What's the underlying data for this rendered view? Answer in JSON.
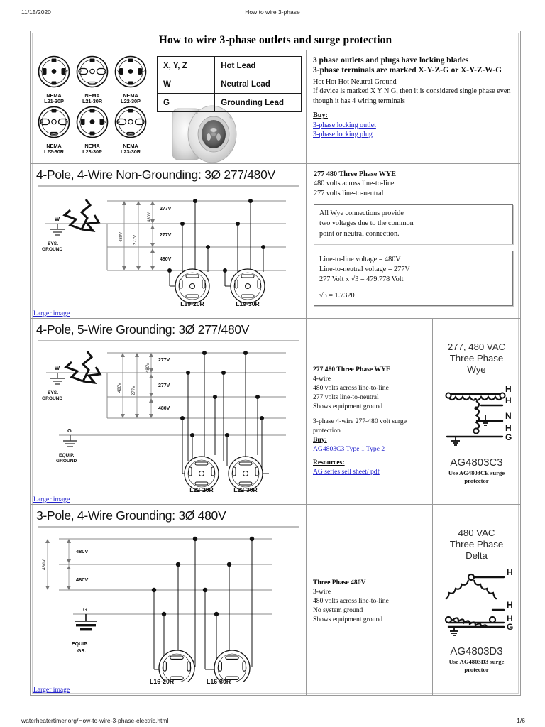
{
  "print_header": {
    "date": "11/15/2020",
    "title": "How to wire 3-phase"
  },
  "print_footer": {
    "url": "waterheatertimer.org/How-to-wire-3-phase-electric.html",
    "page": "1/6"
  },
  "doc_title": "How to wire 3-phase outlets and surge protection",
  "nema_plugs": [
    {
      "line1": "NEMA",
      "line2": "L21-30P",
      "type": "plug"
    },
    {
      "line1": "NEMA",
      "line2": "L21-30R",
      "type": "receptacle"
    },
    {
      "line1": "NEMA",
      "line2": "L22-30P",
      "type": "plug"
    },
    {
      "line1": "NEMA",
      "line2": "L22-30R",
      "type": "receptacle"
    },
    {
      "line1": "NEMA",
      "line2": "L23-30P",
      "type": "plug"
    },
    {
      "line1": "NEMA",
      "line2": "L23-30R",
      "type": "receptacle"
    }
  ],
  "lead_table": {
    "rows": [
      {
        "key": "X, Y, Z",
        "value": "Hot Lead"
      },
      {
        "key": "W",
        "value": "Neutral Lead"
      },
      {
        "key": "G",
        "value": "Grounding Lead"
      }
    ]
  },
  "intro": {
    "line1": "3 phase outlets and plugs have locking blades",
    "line2": "3-phase terminals are marked X-Y-Z-G or X-Y-Z-W-G",
    "line3": "Hot Hot Hot Neutral Ground",
    "line4": "If device is marked X Y N G, then it is considered single phase even though it has 4 wiring terminals",
    "buy_label": "Buy:",
    "links": [
      "3-phase locking outlet",
      "3-phase locking plug"
    ]
  },
  "sections": [
    {
      "id": "row2",
      "title": "4-Pole, 4-Wire Non-Grounding: 3Ø 277/480V",
      "larger_image": "Larger image",
      "diagram": {
        "ground_label_top": "W",
        "ground_caption_top": "SYS.\nGROUND",
        "sys_ground_line1": "SYS.",
        "sys_ground_line2": "GROUND",
        "voltage_stack": [
          "277V",
          "277V",
          "480V"
        ],
        "side_labels": [
          "480V",
          "277V",
          "480V"
        ],
        "receptacles": [
          "L19-20R",
          "L19-30R"
        ]
      },
      "text": {
        "heading": "277 480 Three Phase WYE",
        "lines": [
          "480 volts across line-to-line",
          "277 volts line-to-neutral"
        ],
        "note1": [
          "All Wye connections provide",
          "two voltages due to the common",
          "point or neutral connection."
        ],
        "note2": [
          "Line-to-line voltage = 480V",
          "Line-to-neutral voltage = 277V",
          "277 Volt x √3 = 479.778 Volt",
          "",
          "√3 = 1.7320"
        ]
      }
    },
    {
      "id": "row3",
      "title": "4-Pole, 5-Wire Grounding: 3Ø 277/480V",
      "larger_image": "Larger image",
      "diagram": {
        "neutral_label": "W",
        "sys_ground_line1": "SYS.",
        "sys_ground_line2": "GROUND",
        "ground_label": "G",
        "equip_ground_line1": "EQUIP.",
        "equip_ground_line2": "GROUND",
        "voltage_stack": [
          "277V",
          "277V",
          "480V"
        ],
        "side_labels": [
          "480V",
          "277V",
          "480V"
        ],
        "receptacles": [
          "L22-20R",
          "L22-30R"
        ]
      },
      "text": {
        "heading": "277 480 Three Phase WYE",
        "lines": [
          "4-wire",
          "480 volts across line-to-line",
          "277 volts line-to-neutral",
          "Shows equipment ground"
        ],
        "para2": "3-phase 4-wire 277-480 volt surge protection",
        "buy_label": "Buy:",
        "buy_link": "AG4803C3 Type 1 Type 2",
        "resources_label": "Resources:",
        "resources_link": "AG series sell sheet/ pdf"
      },
      "schematic": {
        "title_line1": "277, 480 VAC",
        "title_line2": "Three Phase",
        "title_line3": "Wye",
        "terminals": [
          "H",
          "H",
          "N",
          "H",
          "G"
        ],
        "part": "AG4803C3",
        "sub_line1": "Use AG4803CE surge",
        "sub_line2": "protector",
        "kind": "wye"
      }
    },
    {
      "id": "row4",
      "title": "3-Pole, 4-Wire Grounding: 3Ø 480V",
      "larger_image": "Larger image",
      "diagram": {
        "ground_label": "G",
        "equip_ground_line1": "EQUIP.",
        "equip_ground_line2": "GR.",
        "voltage_stack": [
          "480V",
          "480V"
        ],
        "side_labels": [
          "480V"
        ],
        "receptacles": [
          "L16-20R",
          "L16-30R"
        ]
      },
      "text": {
        "heading": "Three Phase 480V",
        "lines": [
          "3-wire",
          "480 volts across line-to-line",
          "No system ground",
          "Shows equipment ground"
        ]
      },
      "schematic": {
        "title_line1": "480 VAC",
        "title_line2": "Three Phase",
        "title_line3": "Delta",
        "terminals": [
          "H",
          "H",
          "H",
          "G"
        ],
        "part": "AG4803D3",
        "sub_line1": "Use AG4803D3 surge",
        "sub_line2": "protector",
        "kind": "delta"
      }
    }
  ],
  "colors": {
    "link": "#2222cc",
    "border": "#9a9a9a",
    "text": "#0d0d0d",
    "schematic_text": "#2c2c2c"
  }
}
